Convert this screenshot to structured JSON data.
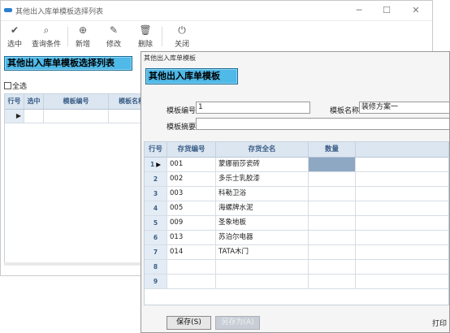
{
  "back_window": {
    "title": "其他出入库单模板选择列表",
    "controls": {
      "minimize": "─",
      "maximize": "☐",
      "close": "✕"
    },
    "toolbar": [
      {
        "name": "select",
        "icon": "✔",
        "label": "选中"
      },
      {
        "name": "query",
        "icon": "⌕",
        "label": "查询条件"
      },
      {
        "name": "add",
        "icon": "⊕",
        "label": "新增"
      },
      {
        "name": "edit",
        "icon": "✎",
        "label": "修改"
      },
      {
        "name": "delete",
        "icon": "🗑",
        "label": "删除"
      },
      {
        "name": "close",
        "icon": "⏻",
        "label": "关闭"
      }
    ],
    "header": "其他出入库单模板选择列表",
    "select_all_label": "全选",
    "grid_columns": [
      "行号",
      "选中",
      "模板编号",
      "模板名称"
    ]
  },
  "front_window": {
    "title": "其他出入库单模板",
    "header": "其他出入库单模板",
    "form": {
      "template_no_label": "模板编号",
      "template_no_value": "1",
      "template_name_label": "模板名称",
      "template_name_value": "装修方案一",
      "summary_label": "模板摘要",
      "summary_value": ""
    },
    "grid": {
      "columns": [
        "行号",
        "存货编号",
        "存货全名",
        "数量"
      ],
      "rows": [
        {
          "num": "1",
          "code": "001",
          "name": "蒙娜丽莎瓷砖",
          "qty": ""
        },
        {
          "num": "2",
          "code": "002",
          "name": "多乐士乳胶漆",
          "qty": ""
        },
        {
          "num": "3",
          "code": "003",
          "name": "科勒卫浴",
          "qty": ""
        },
        {
          "num": "4",
          "code": "005",
          "name": "海螺牌水泥",
          "qty": ""
        },
        {
          "num": "5",
          "code": "009",
          "name": "圣象地板",
          "qty": ""
        },
        {
          "num": "6",
          "code": "013",
          "name": "苏泊尔电器",
          "qty": ""
        },
        {
          "num": "7",
          "code": "014",
          "name": "TATA木门",
          "qty": ""
        },
        {
          "num": "8",
          "code": "",
          "name": "",
          "qty": ""
        },
        {
          "num": "9",
          "code": "",
          "name": "",
          "qty": ""
        }
      ],
      "current_row_marker": "▶"
    },
    "buttons": {
      "save": "保存(S)",
      "save_as": "另存为(A)",
      "print": "打印"
    }
  },
  "colors": {
    "header_blue": "#4fb9e7",
    "grid_header": "#dbe6f1",
    "selected_cell": "#8ea7c3"
  }
}
